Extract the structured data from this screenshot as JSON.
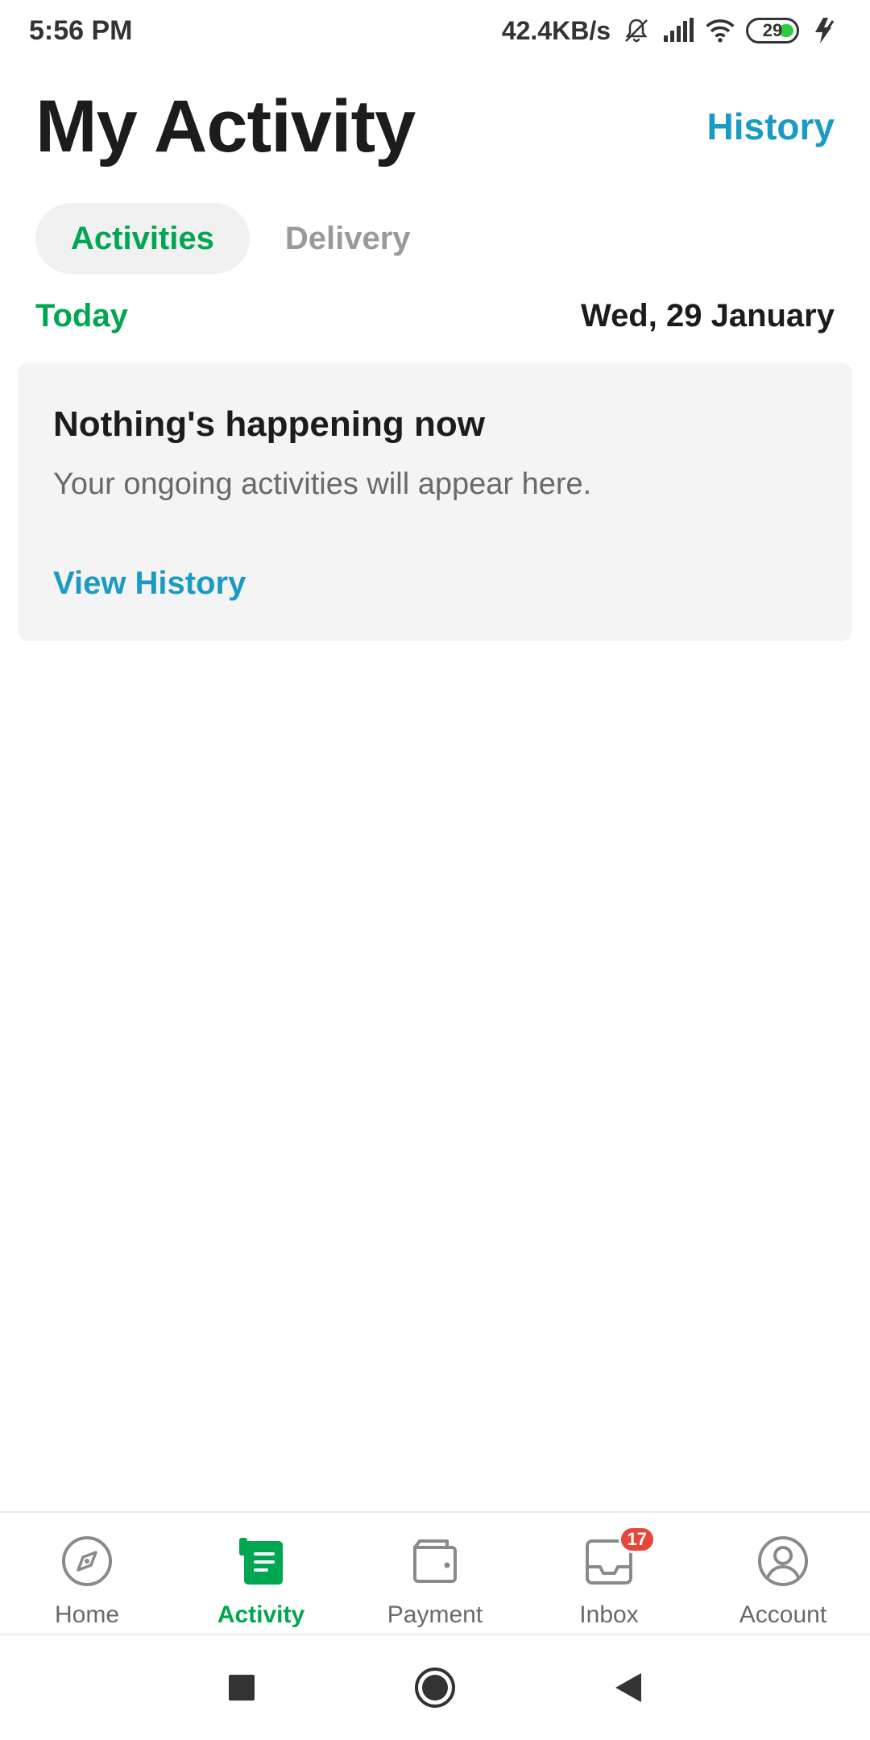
{
  "status_bar": {
    "time": "5:56 PM",
    "net_speed": "42.4KB/s",
    "battery": "29",
    "icons": [
      "bell-muted-icon",
      "signal-icon",
      "wifi-icon",
      "battery-icon",
      "charging-icon"
    ]
  },
  "header": {
    "title": "My Activity",
    "history_label": "History"
  },
  "tabs": [
    {
      "label": "Activities",
      "active": true
    },
    {
      "label": "Delivery",
      "active": false
    }
  ],
  "date_row": {
    "today_label": "Today",
    "date": "Wed, 29 January"
  },
  "empty_state": {
    "title": "Nothing's happening now",
    "subtitle": "Your ongoing activities will appear here.",
    "link": "View History"
  },
  "bottom_nav": {
    "items": [
      {
        "label": "Home",
        "icon": "compass-icon"
      },
      {
        "label": "Activity",
        "icon": "activity-icon",
        "active": true
      },
      {
        "label": "Payment",
        "icon": "wallet-icon"
      },
      {
        "label": "Inbox",
        "icon": "inbox-icon",
        "badge": "17"
      },
      {
        "label": "Account",
        "icon": "account-icon"
      }
    ]
  },
  "colors": {
    "brand_green": "#00a650",
    "link_blue": "#1a9bc4",
    "badge_red": "#e8463b"
  }
}
